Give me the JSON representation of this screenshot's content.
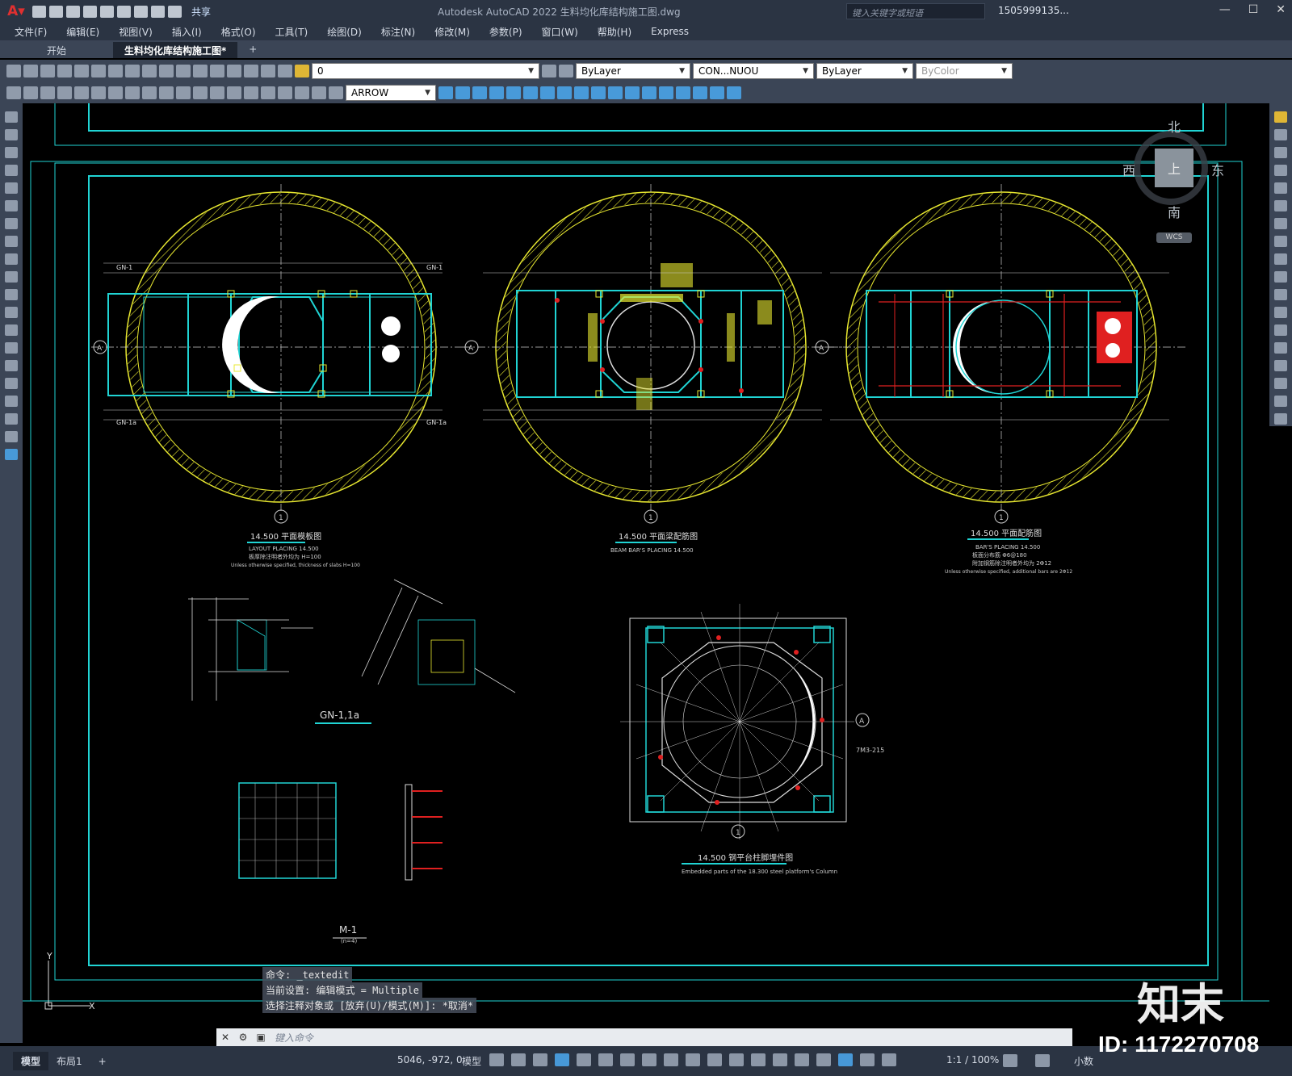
{
  "window": {
    "title": "Autodesk AutoCAD 2022    生料均化库结构施工图.dwg",
    "share_label": "共享",
    "search_placeholder": "键入关键字或短语",
    "user": "1505999135...",
    "minimize": "—",
    "maximize": "☐",
    "close": "✕"
  },
  "menu": [
    "文件(F)",
    "编辑(E)",
    "视图(V)",
    "插入(I)",
    "格式(O)",
    "工具(T)",
    "绘图(D)",
    "标注(N)",
    "修改(M)",
    "参数(P)",
    "窗口(W)",
    "帮助(H)",
    "Express"
  ],
  "tabs": {
    "start": "开始",
    "drawing": "生料均化库结构施工图*",
    "add": "+"
  },
  "toolbar": {
    "layer": "0",
    "color": "ByLayer",
    "linetype": "CON...NUOU",
    "lineweight": "ByLayer",
    "plotstyle": "ByColor",
    "dimstyle": "ARROW"
  },
  "viewcube": {
    "north": "北",
    "south": "南",
    "east": "东",
    "west": "西",
    "top": "上",
    "wcs": "WCS"
  },
  "drawing": {
    "plan1_title": "14.500 平面模板图",
    "plan1_sub1": "LAYOUT PLACING 14.500",
    "plan1_sub2": "板厚除注明者外均为 H=100",
    "plan1_sub3": "Unless otherwise specified, thickness of slabs H=100",
    "plan2_title": "14.500 平面梁配筋图",
    "plan2_sub1": "BEAM BAR'S PLACING 14.500",
    "plan3_title": "14.500 平面配筋图",
    "plan3_sub1": "BAR'S PLACING 14.500",
    "plan3_sub2": "板面分布筋 Φ6@180",
    "plan3_sub3": "附加钢筋除注明者外均为 2Φ12",
    "plan3_sub4": "Unless otherwise specified, additional bars are 2Φ12",
    "gn_title": "GN-1,1a",
    "m1_title": "M-1",
    "m1_sub": "(n=4)",
    "col_title": "14.500 钢平台柱脚埋件图",
    "col_sub": "Embedded parts of the 18.300 steel platform's Column",
    "axis_a": "A",
    "axis_1": "1",
    "gn1": "GN-1",
    "gn1a": "GN-1a",
    "tm": "7M3-215"
  },
  "command": {
    "line1": "命令: _textedit",
    "line2": "当前设置: 编辑模式 = Multiple",
    "line3": "选择注释对象或 [放弃(U)/模式(M)]: *取消*",
    "prompt": "键入命令"
  },
  "status": {
    "model_tab": "模型",
    "layout_tab": "布局1",
    "add": "+",
    "coords": "5046, -972, 0",
    "model_label": "模型",
    "scale": "1:1 / 100%",
    "units": "小数"
  },
  "watermark": {
    "brand": "知末",
    "id": "ID: 1172270708"
  },
  "colors": {
    "accent": "#4aa3e8",
    "cyan": "#20d4d4",
    "yellow": "#e8e830",
    "red": "#e02020",
    "chrome": "#2b3443"
  }
}
